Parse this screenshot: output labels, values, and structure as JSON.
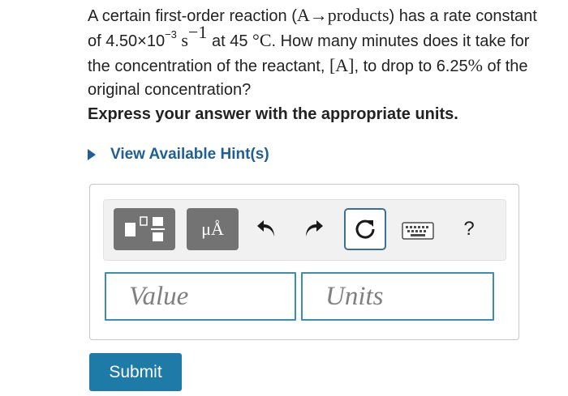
{
  "question": {
    "text_1": "A certain first-order reaction (",
    "reaction": "A→products",
    "text_2": ") has a rate constant of 4.50×10",
    "rate_exp": "−3",
    "text_unit": " s",
    "unit_exp": "−1",
    "text_3": " at 45 ",
    "temp_unit": "°C",
    "text_4": ". How many minutes does it take for the concentration of the reactant, ",
    "reactant": "[A]",
    "text_5": ", to drop to 6.25",
    "percent": "%",
    "text_6": " of the original concentration?"
  },
  "instruction": "Express your answer with the appropriate units.",
  "hint_label": "View Available Hint(s)",
  "toolbar": {
    "units_label": "μÅ",
    "help_label": "?",
    "icons": [
      "templates-icon",
      "units-icon",
      "undo-icon",
      "redo-icon",
      "reset-icon",
      "keyboard-icon",
      "help-icon"
    ]
  },
  "inputs": {
    "value_placeholder": "Value",
    "units_placeholder": "Units"
  },
  "submit_label": "Submit",
  "colors": {
    "link": "#1f5f93",
    "submit_bg": "#1e7aa6",
    "field_border": "#3c8db5",
    "tool_bg": "#737373"
  }
}
